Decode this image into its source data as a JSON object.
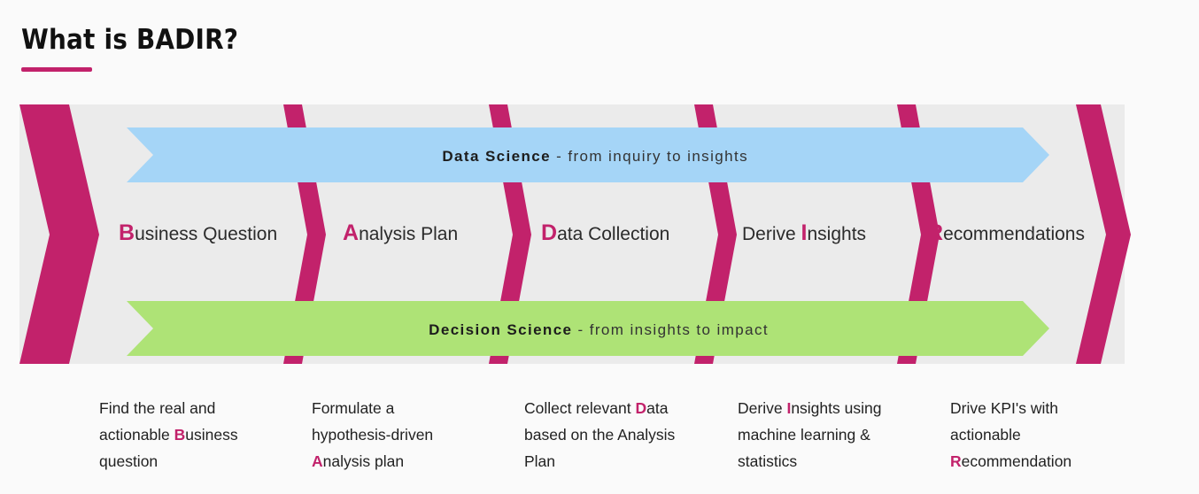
{
  "header": {
    "title": "What is BADIR?",
    "accent_color": "#c2226b"
  },
  "colors": {
    "pink": "#c2226b",
    "band_gray": "#ebebeb",
    "blue_bar": "#a5d5f7",
    "green_bar": "#aee376",
    "page_bg": "#fafafa",
    "text": "#222222"
  },
  "diagram": {
    "top_banner": {
      "name": "Data Science",
      "separator": "-",
      "tagline": "from inquiry to insights",
      "color": "#a5d5f7"
    },
    "bottom_banner": {
      "name": "Decision Science",
      "separator": "-",
      "tagline": "from insights to impact",
      "color": "#aee376"
    },
    "stages": [
      {
        "accent": "B",
        "rest": "usiness Question",
        "accent_position": "start",
        "prefix": ""
      },
      {
        "accent": "A",
        "rest": "nalysis Plan",
        "accent_position": "start",
        "prefix": ""
      },
      {
        "accent": "D",
        "rest": "ata Collection",
        "accent_position": "start",
        "prefix": ""
      },
      {
        "accent": "I",
        "rest": "nsights",
        "accent_position": "middle",
        "prefix": "Derive "
      },
      {
        "accent": "R",
        "rest": "ecommendations",
        "accent_position": "start",
        "prefix": ""
      }
    ]
  },
  "descriptions": [
    {
      "line1": "Find the real and",
      "line2_pre": "actionable ",
      "line2_accent": "B",
      "line2_post": "usiness",
      "line3": "question"
    },
    {
      "line1": "Formulate a",
      "line2_pre": "hypothesis-driven",
      "line2_accent": "",
      "line2_post": "",
      "line3_accent": "A",
      "line3_post": "nalysis plan"
    },
    {
      "line1_pre": "Collect relevant ",
      "line1_accent": "D",
      "line1_post": "ata",
      "line2": "based on the Analysis",
      "line3": "Plan"
    },
    {
      "line1_pre": "Derive ",
      "line1_accent": "I",
      "line1_post": "nsights using",
      "line2": "machine learning &",
      "line3": "statistics"
    },
    {
      "line1": "Drive KPI's with",
      "line2": "actionable",
      "line3_accent": "R",
      "line3_post": "ecommendation"
    }
  ]
}
